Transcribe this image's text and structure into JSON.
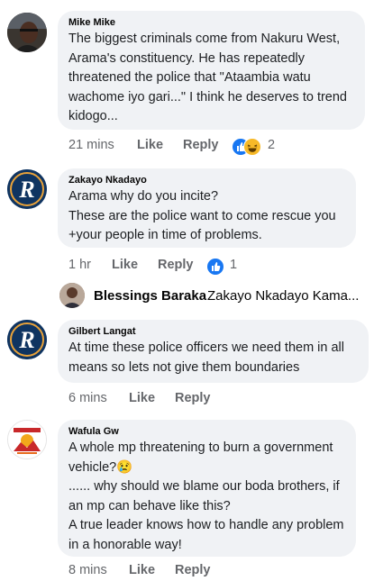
{
  "comments": [
    {
      "author": "Mike Mike",
      "lines": [
        "The biggest criminals come from Nakuru West,",
        "Arama's constituency. He has repeatedly",
        "threatened the police that \"Ataambia watu",
        "wachome iyo gari...\" I think he deserves to trend",
        "kidogo..."
      ],
      "time": "21 mins",
      "like": "Like",
      "reply": "Reply",
      "reaction_count": "2",
      "reactions": [
        "like-icon",
        "haha-icon"
      ]
    },
    {
      "author": "Zakayo Nkadayo",
      "lines": [
        "Arama why do you incite?",
        "These are the police want to come rescue you",
        "+your people in time of problems."
      ],
      "time": "1 hr",
      "like": "Like",
      "reply": "Reply",
      "reaction_count": "1",
      "reactions": [
        "like-icon"
      ]
    },
    {
      "author": "Gilbert Langat",
      "lines": [
        "At time these police officers we need them in all",
        "means so lets not give them boundaries"
      ],
      "time": "6 mins",
      "like": "Like",
      "reply": "Reply"
    },
    {
      "author": "Wafula Gw",
      "lines": [
        "A whole mp threatening to burn a government",
        "vehicle?😢",
        "...... why should we blame our boda brothers, if",
        "an mp can behave like this?",
        "A true leader knows how to handle any problem",
        "in a honorable way!"
      ],
      "time": "8 mins",
      "like": "Like",
      "reply": "Reply"
    }
  ],
  "reply_preview": {
    "name": "Blessings Baraka",
    "snippet": "Zakayo Nkadayo Kama..."
  },
  "colors": {
    "bubble": "#f0f2f5",
    "meta": "#65676b",
    "like_blue": "#1877f2",
    "haha_yellow": "#f7b928"
  }
}
